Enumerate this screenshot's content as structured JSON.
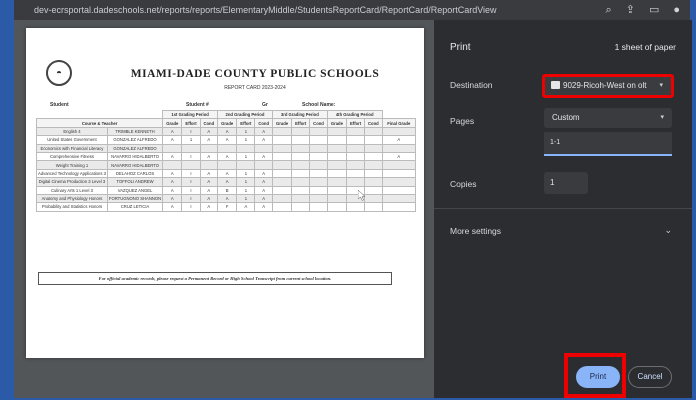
{
  "browser": {
    "url": "dev-ecrsportal.dadeschools.net/reports/reports/ElementaryMiddle/StudentsReportCard/ReportCard/ReportCardView"
  },
  "document": {
    "logo_glyph": "◓",
    "school": "MIAMI-DADE COUNTY PUBLIC SCHOOLS",
    "report_title": "REPORT CARD 2023-2024",
    "student_label": "Student",
    "student_id_label": "Student #",
    "grade_label": "Gr",
    "school_name_label": "School Name:",
    "periods": [
      "1st Grading Period",
      "2nd Grading Period",
      "3rd Grading Period",
      "4th Grading Period"
    ],
    "course_teacher_header": "Course & Teacher",
    "sub_headers": [
      "Grade",
      "Effort",
      "Cond"
    ],
    "final_grade_header": "Final Grade",
    "rows": [
      {
        "course": "English 4",
        "teacher": "TRIMBLE KENNETH",
        "g1": [
          "A",
          "I",
          "A"
        ],
        "g2": [
          "A",
          "1",
          "A"
        ],
        "final": ""
      },
      {
        "course": "United States Government",
        "teacher": "GONZALEZ ALFREDO",
        "g1": [
          "A",
          "1",
          "A"
        ],
        "g2": [
          "A",
          "1",
          "A"
        ],
        "final": "A"
      },
      {
        "course": "Economics with Financial Literacy",
        "teacher": "GONZALEZ ALFREDO",
        "g1": [
          "",
          "",
          ""
        ],
        "g2": [
          "",
          "",
          ""
        ],
        "final": ""
      },
      {
        "course": "Comprehensive Fitness",
        "teacher": "NAVARRO HIDALBERTO",
        "g1": [
          "A",
          "I",
          "A"
        ],
        "g2": [
          "A",
          "1",
          "A"
        ],
        "final": "A"
      },
      {
        "course": "Weight Training 1",
        "teacher": "NAVARRO HIDALBERTO",
        "g1": [
          "",
          "",
          ""
        ],
        "g2": [
          "",
          "",
          ""
        ],
        "final": ""
      },
      {
        "course": "Advanced Technology Applications 3",
        "teacher": "DELAHOZ CARLOS",
        "g1": [
          "A",
          "I",
          "A"
        ],
        "g2": [
          "A",
          "1",
          "A"
        ],
        "final": ""
      },
      {
        "course": "Digital Cinema Production 3 Level 3",
        "teacher": "TOFFOLI ANDREW",
        "g1": [
          "A",
          "I",
          "A"
        ],
        "g2": [
          "A",
          "1",
          "A"
        ],
        "final": ""
      },
      {
        "course": "Culinary Arts 1 Level 3",
        "teacher": "VAZQUEZ ANGEL",
        "g1": [
          "A",
          "I",
          "A"
        ],
        "g2": [
          "B",
          "1",
          "A"
        ],
        "final": ""
      },
      {
        "course": "Anatomy and Physiology Honors",
        "teacher": "FORTUGNONO SHANNON",
        "g1": [
          "A",
          "I",
          "A"
        ],
        "g2": [
          "A",
          "1",
          "A"
        ],
        "final": ""
      },
      {
        "course": "Probability and Statistics Honors",
        "teacher": "CRUZ LETICIA",
        "g1": [
          "A",
          "I",
          "A"
        ],
        "g2": [
          "F",
          "A",
          "A"
        ],
        "final": ""
      }
    ],
    "note": "For official academic records, please request a Permanent Record or High School Transcript from current school location."
  },
  "print_panel": {
    "title": "Print",
    "sheet_count": "1 sheet of paper",
    "destination_label": "Destination",
    "destination_value": "9029-Ricoh-West on olt",
    "pages_label": "Pages",
    "pages_value": "Custom",
    "page_range": "1-1",
    "copies_label": "Copies",
    "copies_value": "1",
    "more_settings": "More settings",
    "print_button": "Print",
    "cancel_button": "Cancel"
  },
  "colors": {
    "highlight": "#e00000",
    "accent": "#8ab4f8",
    "panel_bg": "#2c2d30",
    "frame_bg": "#2b5aa8"
  }
}
